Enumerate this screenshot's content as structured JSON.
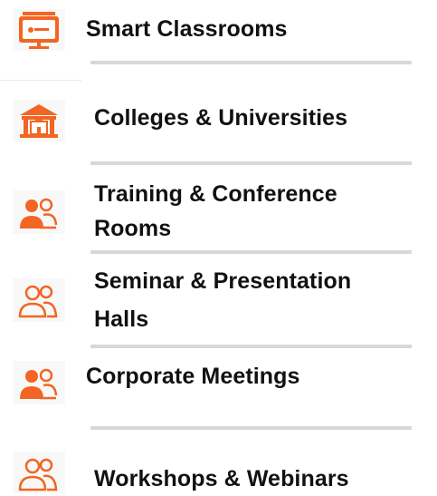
{
  "accent_color": "#F26522",
  "items": [
    {
      "label": "Smart Classrooms",
      "icon": "smart-board-icon"
    },
    {
      "label": "Colleges & Universities",
      "icon": "university-building-icon"
    },
    {
      "label": "Training & Conference Rooms",
      "label_lines": [
        "Training & Conference",
        "Rooms"
      ],
      "icon": "users-group-icon"
    },
    {
      "label": "Seminar & Presentation Halls",
      "label_lines": [
        "Seminar & Presentation",
        "Halls"
      ],
      "icon": "users-outline-icon"
    },
    {
      "label": "Corporate Meetings",
      "icon": "users-group-icon"
    },
    {
      "label": "Workshops & Webinars",
      "icon": "users-outline-icon"
    }
  ]
}
